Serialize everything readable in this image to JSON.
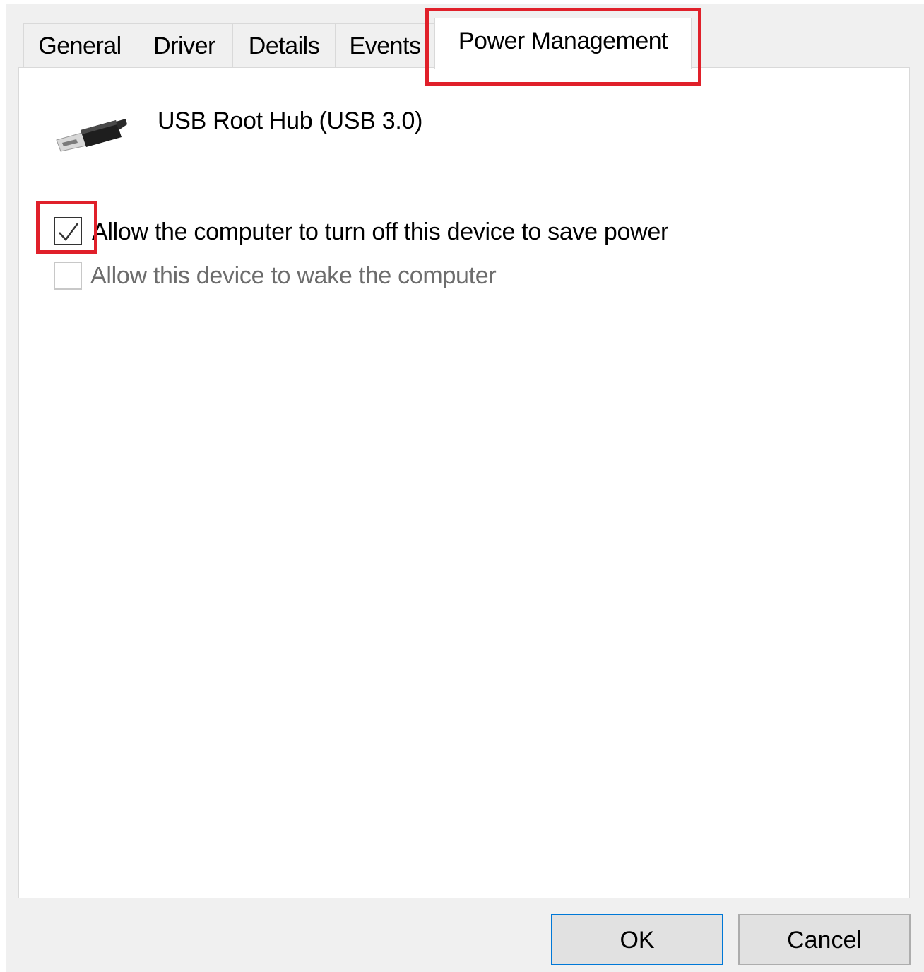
{
  "tabs": [
    {
      "label": "General",
      "active": false
    },
    {
      "label": "Driver",
      "active": false
    },
    {
      "label": "Details",
      "active": false
    },
    {
      "label": "Events",
      "active": false
    },
    {
      "label": "Power Management",
      "active": true
    }
  ],
  "device": {
    "name": "USB Root Hub (USB 3.0)",
    "icon": "usb-cable-icon"
  },
  "options": [
    {
      "label": "Allow the computer to turn off this device to save power",
      "checked": true,
      "enabled": true
    },
    {
      "label": "Allow this device to wake the computer",
      "checked": false,
      "enabled": false
    }
  ],
  "buttons": {
    "ok": "OK",
    "cancel": "Cancel"
  },
  "colors": {
    "highlight": "#e0202a",
    "default_button_border": "#0078d7"
  }
}
